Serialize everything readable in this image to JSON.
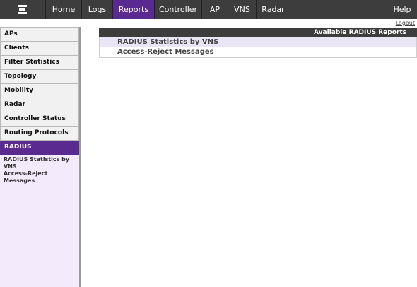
{
  "nav": {
    "tabs": [
      {
        "label": "Home"
      },
      {
        "label": "Logs"
      },
      {
        "label": "Reports"
      },
      {
        "label": "Controller"
      },
      {
        "label": "AP"
      },
      {
        "label": "VNS"
      },
      {
        "label": "Radar"
      },
      {
        "label": "Help"
      }
    ],
    "active_tab": "Reports"
  },
  "logout_label": "Logout",
  "sidebar": {
    "items": [
      {
        "label": "APs"
      },
      {
        "label": "Clients"
      },
      {
        "label": "Filter Statistics"
      },
      {
        "label": "Topology"
      },
      {
        "label": "Mobility"
      },
      {
        "label": "Radar"
      },
      {
        "label": "Controller Status"
      },
      {
        "label": "Routing Protocols"
      },
      {
        "label": "RADIUS"
      }
    ],
    "active_item": "RADIUS",
    "submenu": [
      {
        "label": "RADIUS Statistics by VNS"
      },
      {
        "label": "Access-Reject Messages"
      }
    ]
  },
  "main": {
    "header": "Available RADIUS Reports",
    "reports": [
      {
        "label": "RADIUS Statistics by VNS"
      },
      {
        "label": "Access-Reject Messages"
      }
    ]
  },
  "colors": {
    "nav_bg": "#3d3d3d",
    "accent": "#5b2a91",
    "sidebar_bg": "#f3eafc",
    "row_shade": "#e9e5f7"
  },
  "icons": {
    "logo": "extreme-networks-logo-icon"
  }
}
